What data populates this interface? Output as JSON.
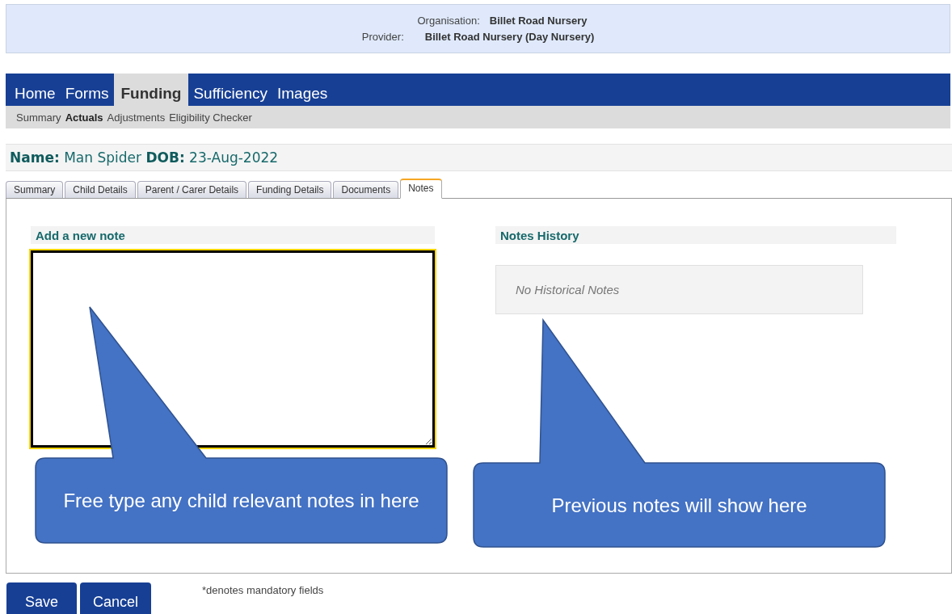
{
  "header": {
    "organisation_label": "Organisation:",
    "organisation": "Billet Road Nursery",
    "provider_label": "Provider:",
    "provider": "Billet Road Nursery (Day Nursery)"
  },
  "nav": [
    {
      "label": "Home",
      "selected": false
    },
    {
      "label": "Forms",
      "selected": false
    },
    {
      "label": "Funding",
      "selected": true
    },
    {
      "label": "Sufficiency",
      "selected": false
    },
    {
      "label": "Images",
      "selected": false
    }
  ],
  "subnav": [
    {
      "label": "Summary",
      "selected": false
    },
    {
      "label": "Actuals",
      "selected": true
    },
    {
      "label": "Adjustments",
      "selected": false
    },
    {
      "label": "Eligibility Checker",
      "selected": false
    }
  ],
  "record_title": "**Name:** Man Spider **DOB:** 23-Aug-2022",
  "tabs": [
    {
      "label": "Summary",
      "selected": false
    },
    {
      "label": "Child Details",
      "selected": false
    },
    {
      "label": "Parent / Carer Details",
      "selected": false
    },
    {
      "label": "Funding Details",
      "selected": false
    },
    {
      "label": "Documents",
      "selected": false
    },
    {
      "label": "Notes",
      "selected": true
    }
  ],
  "new_note": {
    "heading": "Add a new note",
    "focused": true
  },
  "history": {
    "heading": "Notes History",
    "empty_message": "No Historical Notes"
  },
  "callouts": [
    {
      "text": "Free type any child relevant notes in here"
    },
    {
      "text": "Previous notes will show here"
    }
  ],
  "buttons": [
    "Save",
    "Cancel"
  ],
  "footnote": "*denotes mandatory fields"
}
